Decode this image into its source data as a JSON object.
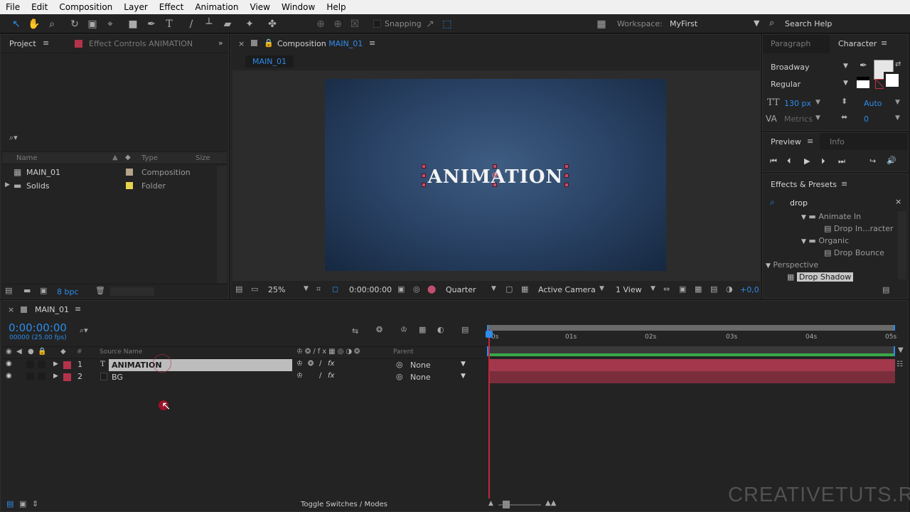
{
  "menu": [
    "File",
    "Edit",
    "Composition",
    "Layer",
    "Effect",
    "Animation",
    "View",
    "Window",
    "Help"
  ],
  "toolbar": {
    "snapping_label": "Snapping",
    "workspace_label": "Workspace:",
    "workspace_value": "MyFirst",
    "search_help": "Search Help"
  },
  "project": {
    "tab_label": "Project",
    "effect_controls_label": "Effect Controls ANIMATION",
    "columns": {
      "name": "Name",
      "type": "Type",
      "size": "Size"
    },
    "items": [
      {
        "name": "MAIN_01",
        "type": "Composition",
        "label_color": "#b5a48a",
        "icon": "composition-icon"
      },
      {
        "name": "Solids",
        "type": "Folder",
        "label_color": "#e6d44a",
        "icon": "folder-icon"
      }
    ],
    "bpc": "8 bpc"
  },
  "composition": {
    "tab_prefix": "Composition",
    "tab_name": "MAIN_01",
    "sub_tab": "MAIN_01",
    "canvas_text": "ANIMATION",
    "zoom": "25%",
    "timecode": "0:00:00:00",
    "resolution": "Quarter",
    "camera": "Active Camera",
    "views": "1 View",
    "exposure": "+0,0"
  },
  "character": {
    "tab_paragraph": "Paragraph",
    "tab_character": "Character",
    "font": "Broadway",
    "style": "Regular",
    "size": "130 px",
    "leading": "Auto",
    "kerning": "Metrics",
    "tracking": "0"
  },
  "preview": {
    "tab_preview": "Preview",
    "tab_info": "Info"
  },
  "effects": {
    "tab_label": "Effects & Presets",
    "search_value": "drop",
    "tree": [
      {
        "label": "Animate In",
        "kind": "folder",
        "level": 1
      },
      {
        "label": "Drop In...racter",
        "kind": "preset",
        "level": 2
      },
      {
        "label": "Organic",
        "kind": "folder",
        "level": 1
      },
      {
        "label": "Drop Bounce",
        "kind": "preset",
        "level": 2
      },
      {
        "label": "Perspective",
        "kind": "category",
        "level": 0
      },
      {
        "label": "Drop Shadow",
        "kind": "effect",
        "level": 1
      }
    ]
  },
  "timeline": {
    "tab_label": "MAIN_01",
    "timecode": "0:00:00:00",
    "frame_info": "00000 (25.00 fps)",
    "col_source": "Source Name",
    "col_parent": "Parent",
    "col_num": "#",
    "layers": [
      {
        "num": "1",
        "name": "ANIMATION",
        "parent": "None",
        "selected": true
      },
      {
        "num": "2",
        "name": "BG",
        "parent": "None",
        "selected": false
      }
    ],
    "ruler": [
      "0s",
      "01s",
      "02s",
      "03s",
      "04s",
      "05s"
    ],
    "toggle_label": "Toggle Switches / Modes"
  },
  "watermark": "CREATIVETUTS.RU"
}
